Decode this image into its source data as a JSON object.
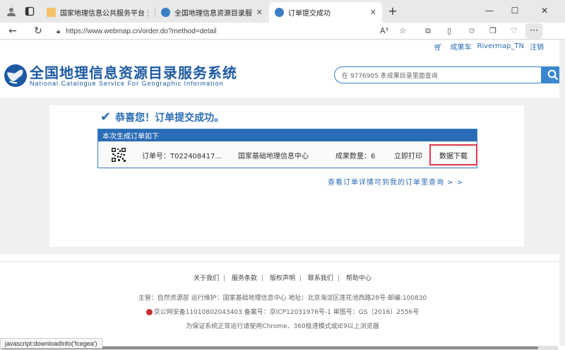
{
  "browser": {
    "tabs": [
      {
        "label": "国家地理信息公共服务平台 天地图",
        "active": false
      },
      {
        "label": "全国地理信息资源目录服务系统",
        "active": false
      },
      {
        "label": "订单提交成功",
        "active": true
      }
    ],
    "url": "https://www.webmap.cn/order.do?method=detail",
    "read_aloud": "A³",
    "more": "···"
  },
  "header": {
    "cart": "成果车",
    "username": "Rivermap_TN",
    "logout": "注销",
    "logo_cn": "全国地理信息资源目录服务系统",
    "logo_en": "National Catalogue Service For Geographic Information",
    "search_placeholder": "在 9776905 条成果目录里面查询"
  },
  "main": {
    "success_message": "恭喜您！订单提交成功。",
    "order_panel_title": "本次生成订单如下",
    "order": {
      "order_no": "订单号：T022408417...",
      "provider": "国家基础地理信息中心",
      "quantity": "成果数量：6",
      "print": "立即打印",
      "download": "数据下载"
    },
    "view_link": "查看订单详情可到我的订单里查询 > >"
  },
  "footer": {
    "links": [
      "关于我们",
      "服务条款",
      "版权声明",
      "联系我们",
      "帮助中心"
    ],
    "line1": "主管：自然资源部 运行维护：国家基础地理信息中心 地址：北京海淀区莲花池西路28号 邮编:100830",
    "line2": "京公网安备11010802043403 备案号：京ICP12031976号-1 审图号：GS（2016）2556号",
    "line3": "为保证系统正常运行请使用Chrome、360极速模式或IE9以上浏览器"
  },
  "status_bar": "javascript:downloadInfo('fcegea')",
  "colors": {
    "accent": "#2a6cb5",
    "highlight": "#e0394d"
  }
}
